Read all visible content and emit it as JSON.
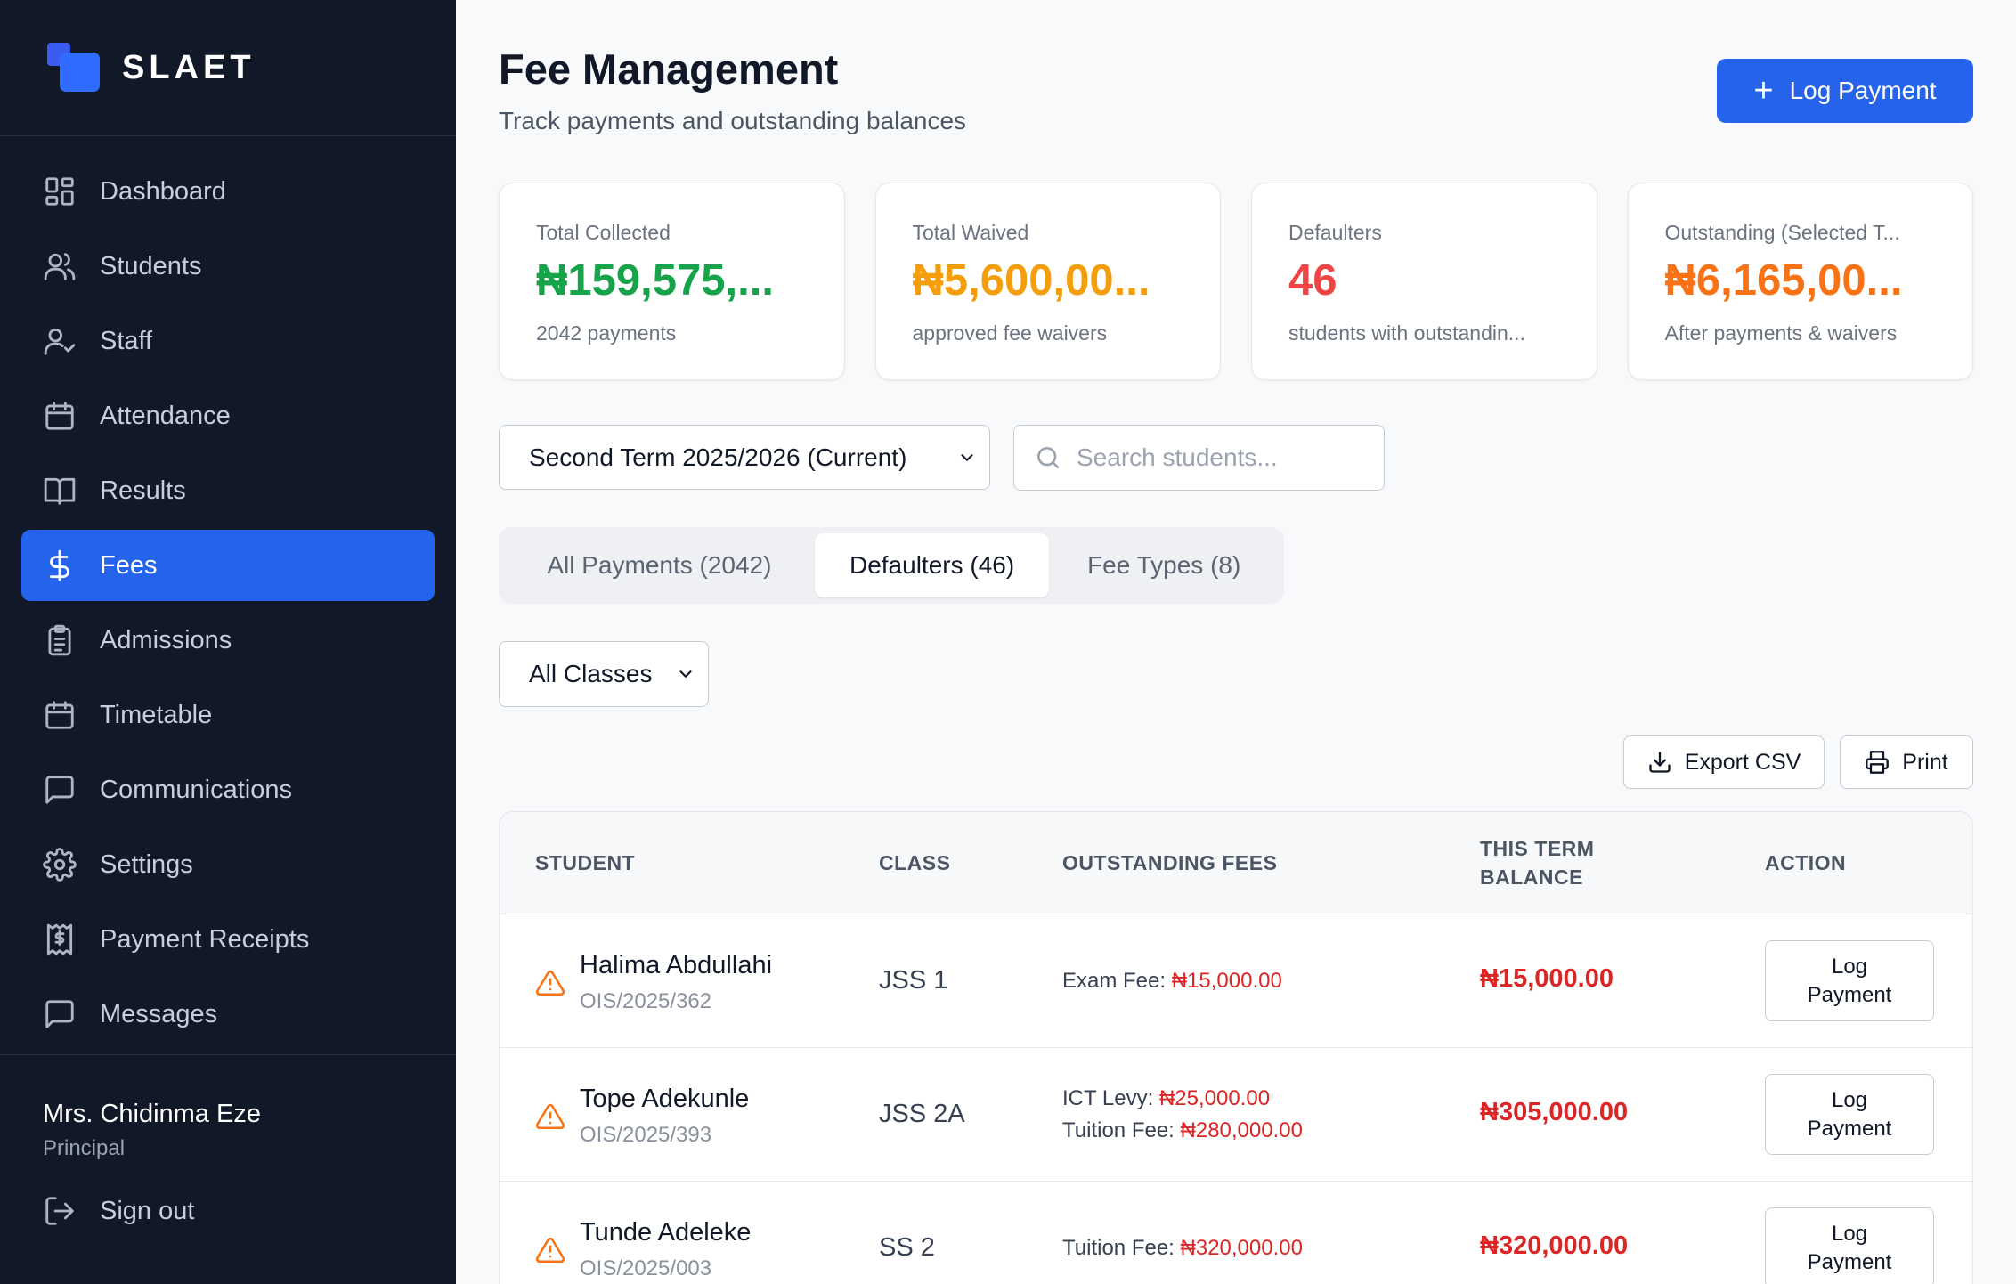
{
  "brand": {
    "name": "SLAET"
  },
  "sidebar": {
    "items": [
      {
        "label": "Dashboard",
        "icon": "dashboard-icon"
      },
      {
        "label": "Students",
        "icon": "users-icon"
      },
      {
        "label": "Staff",
        "icon": "user-check-icon"
      },
      {
        "label": "Attendance",
        "icon": "calendar-icon"
      },
      {
        "label": "Results",
        "icon": "book-open-icon"
      },
      {
        "label": "Fees",
        "icon": "dollar-icon",
        "active": true
      },
      {
        "label": "Admissions",
        "icon": "clipboard-list-icon"
      },
      {
        "label": "Timetable",
        "icon": "calendar-icon"
      },
      {
        "label": "Communications",
        "icon": "message-square-icon"
      },
      {
        "label": "Settings",
        "icon": "gear-icon"
      },
      {
        "label": "Payment Receipts",
        "icon": "receipt-icon"
      },
      {
        "label": "Messages",
        "icon": "message-square-icon"
      }
    ],
    "user": {
      "name": "Mrs. Chidinma Eze",
      "role": "Principal"
    },
    "signout_label": "Sign out"
  },
  "header": {
    "title": "Fee Management",
    "subtitle": "Track payments and outstanding balances",
    "log_payment_label": "Log Payment"
  },
  "stats": [
    {
      "label": "Total Collected",
      "value": "₦159,575,...",
      "sub": "2042 payments",
      "color": "#16a34a"
    },
    {
      "label": "Total Waived",
      "value": "₦5,600,00...",
      "sub": "approved fee waivers",
      "color": "#f59e0b"
    },
    {
      "label": "Defaulters",
      "value": "46",
      "sub": "students with outstandin...",
      "color": "#ef4444"
    },
    {
      "label": "Outstanding (Selected T...",
      "value": "₦6,165,00...",
      "sub": "After payments & waivers",
      "color": "#f97316"
    }
  ],
  "filters": {
    "term_selected": "Second Term 2025/2026 (Current)",
    "search_placeholder": "Search students...",
    "class_selected": "All Classes"
  },
  "tabs": [
    {
      "label": "All Payments (2042)"
    },
    {
      "label": "Defaulters (46)",
      "active": true
    },
    {
      "label": "Fee Types (8)"
    }
  ],
  "actions": {
    "export_label": "Export CSV",
    "print_label": "Print"
  },
  "table": {
    "headers": {
      "student": "STUDENT",
      "class": "CLASS",
      "outstanding": "OUTSTANDING FEES",
      "balance_line1": "THIS TERM",
      "balance_line2": "BALANCE",
      "action": "ACTION"
    },
    "rows": [
      {
        "name": "Halima Abdullahi",
        "id": "OIS/2025/362",
        "class": "JSS 1",
        "fees": [
          {
            "type": "Exam Fee:",
            "amount": "₦15,000.00"
          }
        ],
        "balance": "₦15,000.00",
        "action": "Log Payment"
      },
      {
        "name": "Tope Adekunle",
        "id": "OIS/2025/393",
        "class": "JSS 2A",
        "fees": [
          {
            "type": "ICT Levy:",
            "amount": "₦25,000.00"
          },
          {
            "type": "Tuition Fee:",
            "amount": "₦280,000.00"
          }
        ],
        "balance": "₦305,000.00",
        "action": "Log Payment"
      },
      {
        "name": "Tunde Adeleke",
        "id": "OIS/2025/003",
        "class": "SS 2",
        "fees": [
          {
            "type": "Tuition Fee:",
            "amount": "₦320,000.00"
          }
        ],
        "balance": "₦320,000.00",
        "action": "Log Payment"
      }
    ]
  }
}
